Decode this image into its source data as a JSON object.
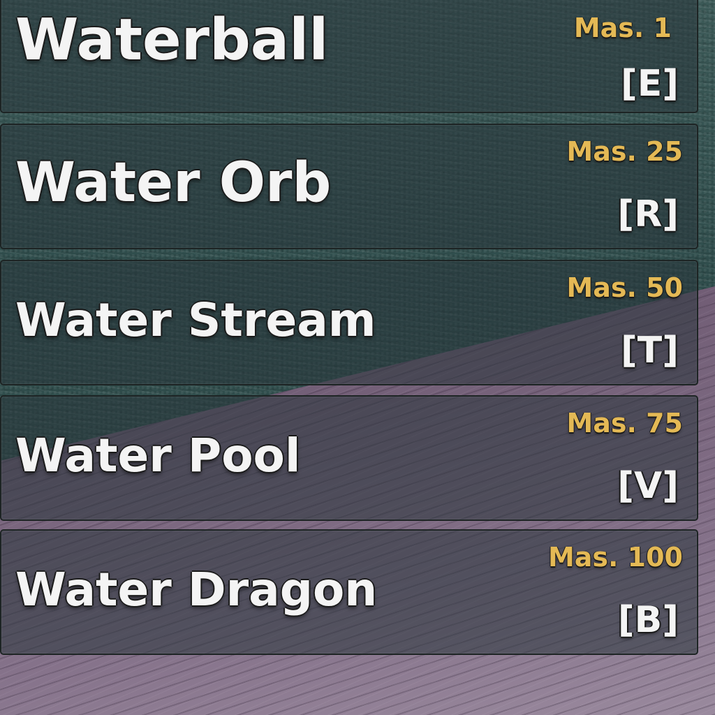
{
  "moves": [
    {
      "name": "Waterball",
      "mastery": "Mas. 1",
      "key": "[E]"
    },
    {
      "name": "Water Orb",
      "mastery": "Mas. 25",
      "key": "[R]"
    },
    {
      "name": "Water Stream",
      "mastery": "Mas. 50",
      "key": "[T]"
    },
    {
      "name": "Water Pool",
      "mastery": "Mas. 75",
      "key": "[V]"
    },
    {
      "name": "Water Dragon",
      "mastery": "Mas. 100",
      "key": "[B]"
    }
  ],
  "colors": {
    "name_text": "#f4f4f4",
    "mastery_text": "#e4b955",
    "slot_border": "#1d2424"
  }
}
